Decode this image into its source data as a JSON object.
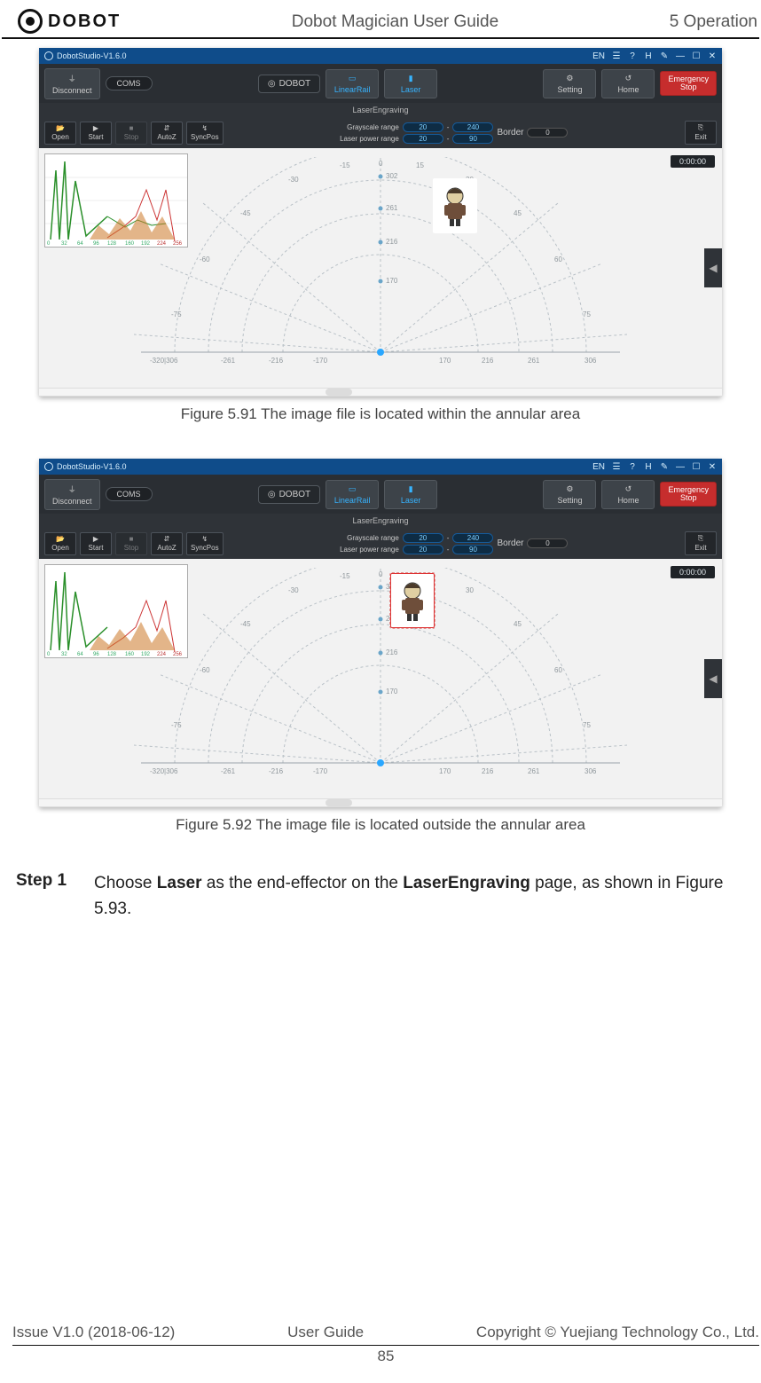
{
  "header": {
    "logo_text": "DOBOT",
    "center": "Dobot Magician User Guide",
    "right_chapter": "5 Operation"
  },
  "app": {
    "title": "DobotStudio-V1.6.0",
    "win_icons": [
      "EN",
      "☰",
      "?",
      "H",
      "✎",
      "—",
      "☐",
      "✕"
    ],
    "topbar": {
      "disconnect": "Disconnect",
      "com": "COMS",
      "brand": "DOBOT",
      "tool1": "LinearRail",
      "tool2": "Laser",
      "setting": "Setting",
      "home": "Home",
      "estop": "Emergency\nStop"
    },
    "subbar": "LaserEngraving",
    "secbar": {
      "open": "Open",
      "start": "Start",
      "stop": "Stop",
      "autoz": "AutoZ",
      "syncpos": "SyncPos",
      "grayscale_label": "Grayscale  range",
      "laser_power_label": "Laser power range",
      "g_min": "20",
      "g_max": "240",
      "lp_min": "20",
      "lp_max": "90",
      "border_label": "Border",
      "border_val": "0",
      "exit": "Exit"
    },
    "timer": "0:00:00",
    "spectrum_ticks": [
      "0",
      "32",
      "64",
      "96",
      "128",
      "160",
      "192",
      "224",
      "256"
    ],
    "axis_ticks": [
      "-320|306",
      "-261",
      "-216",
      "-170",
      "170",
      "216",
      "261",
      "306"
    ],
    "angle_ticks": [
      "-15",
      "0",
      "15",
      "-30",
      "30",
      "-45",
      "45",
      "-60",
      "60",
      "-75",
      "75"
    ],
    "radial_ticks": [
      "302",
      "261",
      "216",
      "170"
    ]
  },
  "fig1": "Figure 5.91    The image file is located within the annular area",
  "fig2": "Figure 5.92    The image file is located outside the annular area",
  "step": {
    "label": "Step 1",
    "pre": "Choose ",
    "b1": "Laser",
    "mid": " as the end-effector on the ",
    "b2": "LaserEngraving",
    "post": " page, as shown in Figure 5.93."
  },
  "footer": {
    "left": "Issue V1.0 (2018-06-12)",
    "center": "User Guide",
    "right": "Copyright © Yuejiang Technology Co., Ltd.",
    "page": "85"
  }
}
